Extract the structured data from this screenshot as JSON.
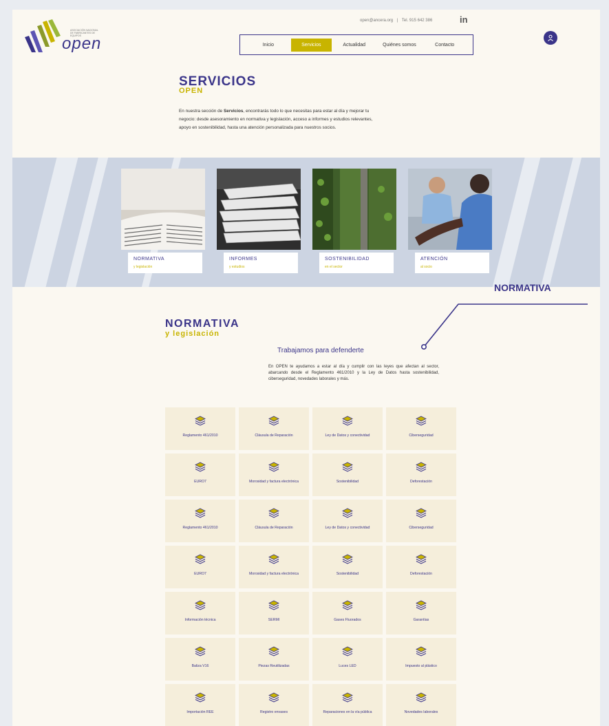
{
  "header": {
    "logo_word": "open",
    "logo_tagline": [
      "ASOCIACIÓN NACIONAL",
      "DE FABRICANTES DE",
      "EQUIPOS"
    ],
    "contact_email": "open@ancera.org",
    "separator": "|",
    "phone": "Tel. 915 642 386",
    "linkedin": "in"
  },
  "nav": {
    "items": [
      {
        "label": "Inicio",
        "active": false
      },
      {
        "label": "Servicios",
        "active": true
      },
      {
        "label": "Actualidad",
        "active": false
      },
      {
        "label": "Quiénes somos",
        "active": false
      },
      {
        "label": "Contacto",
        "active": false
      }
    ]
  },
  "intro": {
    "title": "SERVICIOS",
    "subtitle": "OPEN",
    "text_a": "En nuestra sección de ",
    "text_bold": "Servicios",
    "text_b": ", encontrarás todo lo que necesitas para estar al día y mejorar tu negocio: desde asesoramiento en normativa y legislación, acceso a informes y estudios relevantes, apoyo en sostenibilidad, hasta una atención personalizada para nuestros socios."
  },
  "cards": [
    {
      "title": "NORMATIVA",
      "sub": "y legislación"
    },
    {
      "title": "INFORMES",
      "sub": "y estudios"
    },
    {
      "title": "SOSTENIBILIDAD",
      "sub": "en el sector"
    },
    {
      "title": "ATENCIÓN",
      "sub": "al socio"
    }
  ],
  "callout": {
    "label": "NORMATIVA"
  },
  "normativa": {
    "title": "NORMATIVA",
    "subtitle": "y legislación",
    "section_title": "Trabajamos para defenderte",
    "section_text": "En OPEN te ayudamos a estar al día y cumplir con las leyes que afectan al sector, abarcando desde el Reglamento 461/2010 y la Ley de Datos hasta sostenibilidad, ciberseguridad, novedades laborales y más.",
    "tiles": [
      "Reglamento 461/2010",
      "Cláusula de Reparación",
      "Ley de Datos y conectividad",
      "Ciberseguridad",
      "EURO7",
      "Morosidad y factura electrónica",
      "Sostenibilidad",
      "Deforestación",
      "Reglamento 461/2010",
      "Cláusula de Reparación",
      "Ley de Datos y conectividad",
      "Ciberseguridad",
      "EURO7",
      "Morosidad y factura electrónica",
      "Sostenibilidad",
      "Deforestación",
      "Información técnica",
      "SERMI",
      "Gases Fluorados",
      "Garantías",
      "Baliza V16",
      "Piezas Reutilizadas",
      "Luces LED",
      "Impuesto al plástico",
      "Importación REE",
      "Registro envases",
      "Reparaciones en la vía pública",
      "Novedades laborales"
    ]
  },
  "colors": {
    "brand_purple": "#3a3489",
    "brand_gold": "#c8b400",
    "tile_bg": "#f5eedb",
    "page_bg": "#fbf8f1"
  }
}
